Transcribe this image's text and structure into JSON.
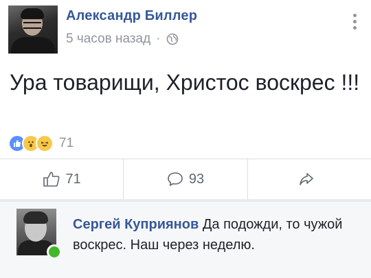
{
  "post": {
    "author": "Александр Биллер",
    "time": "5 часов назад",
    "separator": "·",
    "text": "Ура товарищи, Христос воскрес !!!",
    "reaction_count": "71"
  },
  "actions": {
    "like_count": "71",
    "comment_count": "93"
  },
  "comment": {
    "author": "Сергей Куприянов",
    "text": "Да подожди, то чужой воскрес. Наш через неделю."
  },
  "colors": {
    "link_blue": "#365899",
    "meta_gray": "#90949c",
    "like_blue": "#5890ff",
    "online_green": "#42b72a"
  },
  "icons": [
    "globe-icon",
    "more-icon",
    "like-icon",
    "comment-icon",
    "share-icon"
  ]
}
